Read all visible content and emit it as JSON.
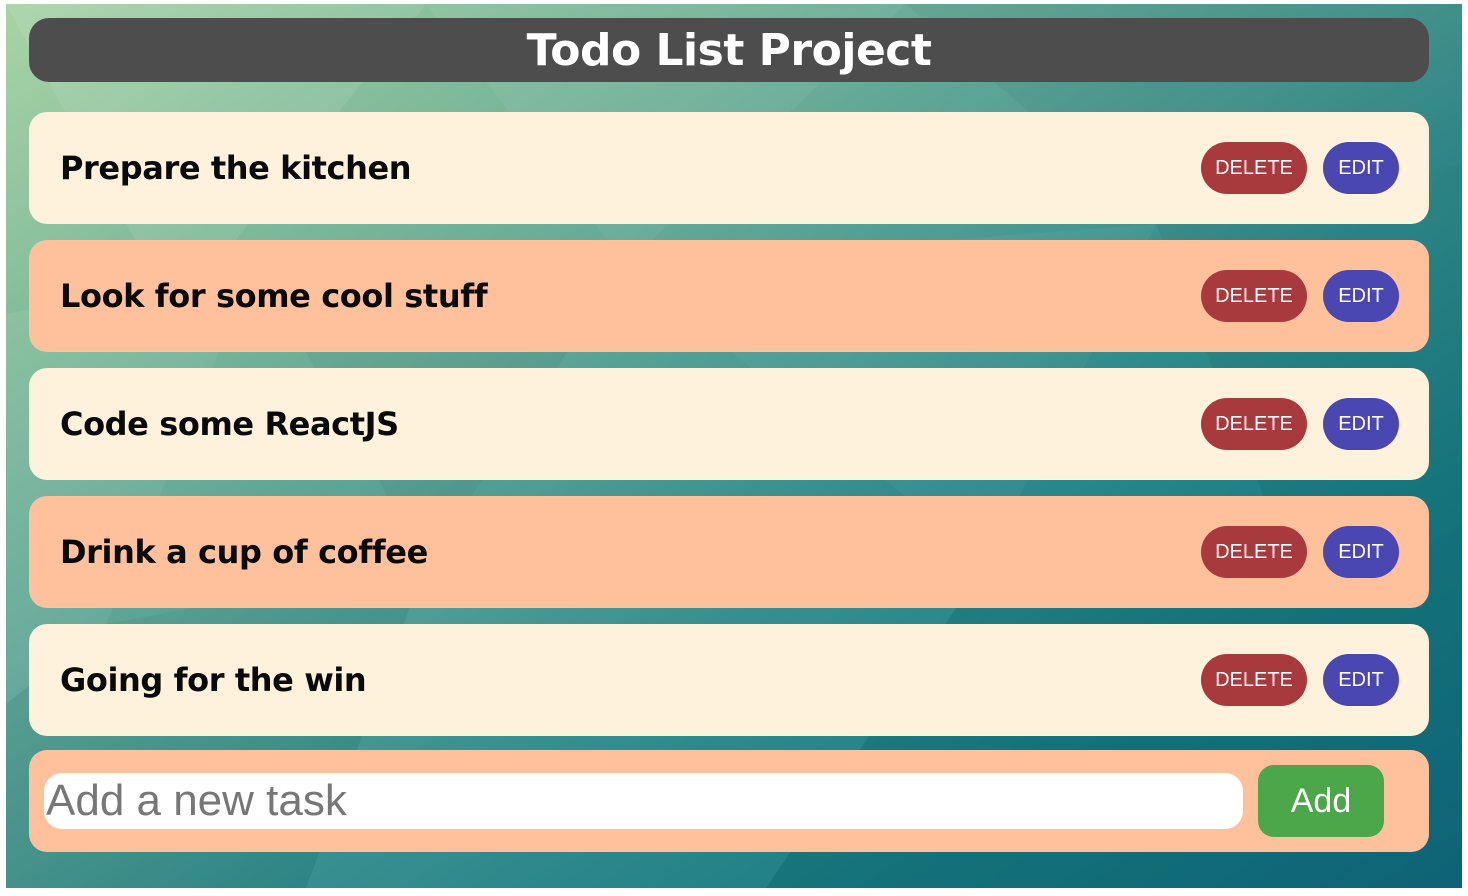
{
  "app": {
    "title": "Todo List Project"
  },
  "todos": [
    {
      "text": "Prepare the kitchen",
      "delete_label": "DELETE",
      "edit_label": "EDIT",
      "background": "#fff2dc"
    },
    {
      "text": "Look for some cool stuff",
      "delete_label": "DELETE",
      "edit_label": "EDIT",
      "background": "#ffc19c"
    },
    {
      "text": "Code some ReactJS",
      "delete_label": "DELETE",
      "edit_label": "EDIT",
      "background": "#fff2dc"
    },
    {
      "text": "Drink a cup of coffee",
      "delete_label": "DELETE",
      "edit_label": "EDIT",
      "background": "#ffc19c"
    },
    {
      "text": "Going for the win",
      "delete_label": "DELETE",
      "edit_label": "EDIT",
      "background": "#fff2dc"
    }
  ],
  "new_task": {
    "value": "",
    "placeholder": "Add a new task",
    "add_label": "Add"
  },
  "colors": {
    "header_background": "#4d4d4d",
    "delete_button": "#a8393c",
    "edit_button": "#4a47b3",
    "add_button": "#4ba74a"
  }
}
